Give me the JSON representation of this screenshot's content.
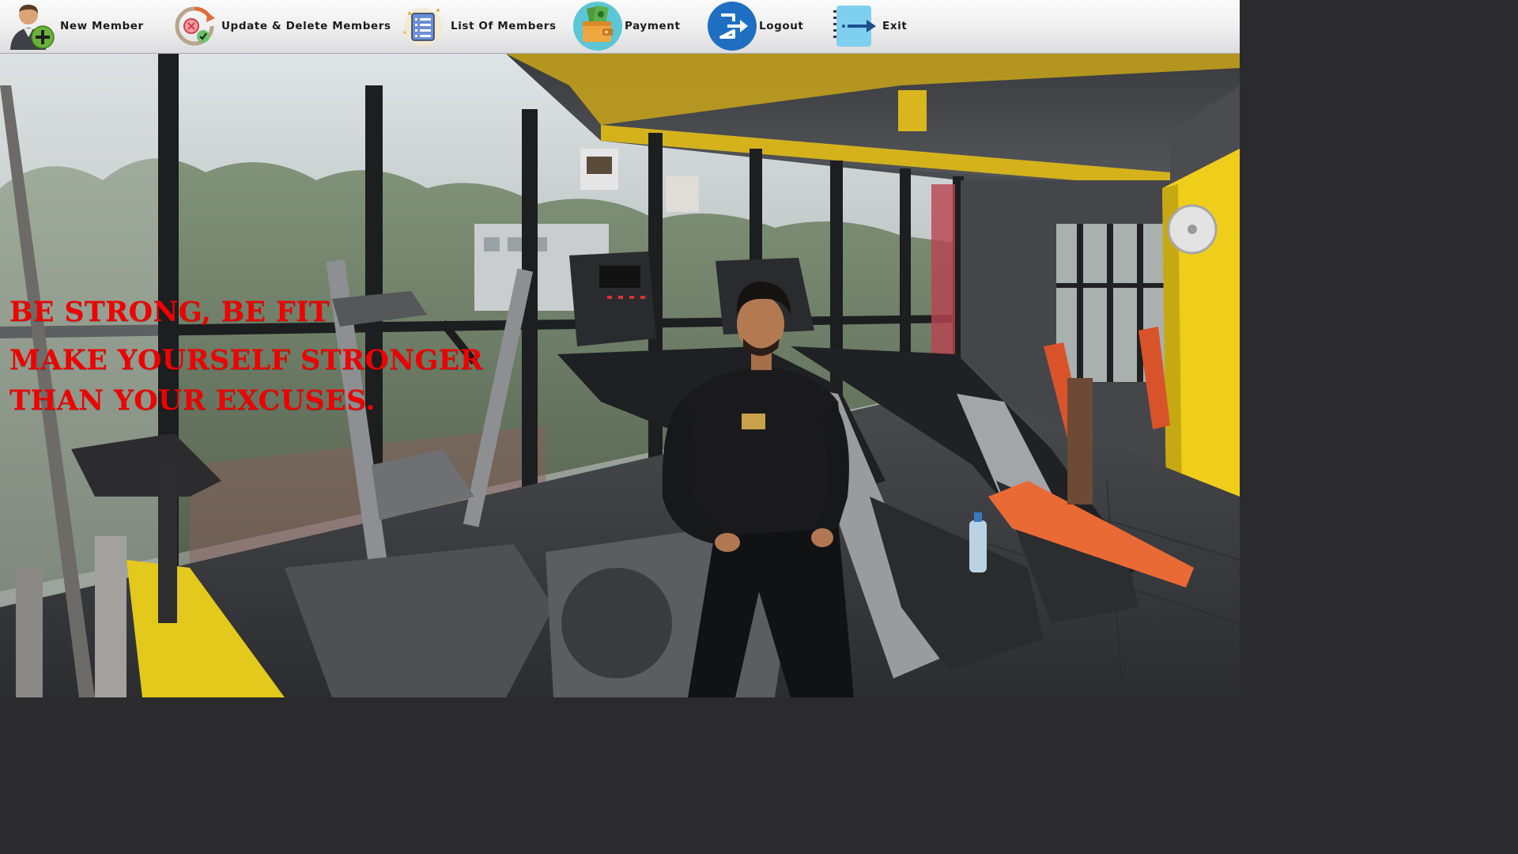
{
  "toolbar": {
    "items": [
      {
        "label": "New Member",
        "icon": "add-user-icon"
      },
      {
        "label": "Update & Delete Members",
        "icon": "update-delete-icon"
      },
      {
        "label": "List Of Members",
        "icon": "list-icon"
      },
      {
        "label": "Payment",
        "icon": "wallet-payment-icon"
      },
      {
        "label": "Logout",
        "icon": "logout-icon"
      },
      {
        "label": "Exit",
        "icon": "exit-icon"
      }
    ]
  },
  "hero": {
    "quote_line_1": "BE STRONG, BE FIT",
    "quote_line_2": "MAKE YOURSELF STRONGER",
    "quote_line_3": "THAN YOUR EXCUSES."
  },
  "colors": {
    "quote_text": "#f00000",
    "toolbar_bg": "#eeeeef",
    "gym_accent_yellow": "#f2d21a",
    "payment_icon_bg": "#5bc6d6",
    "logout_icon_bg": "#1e6fc2"
  }
}
